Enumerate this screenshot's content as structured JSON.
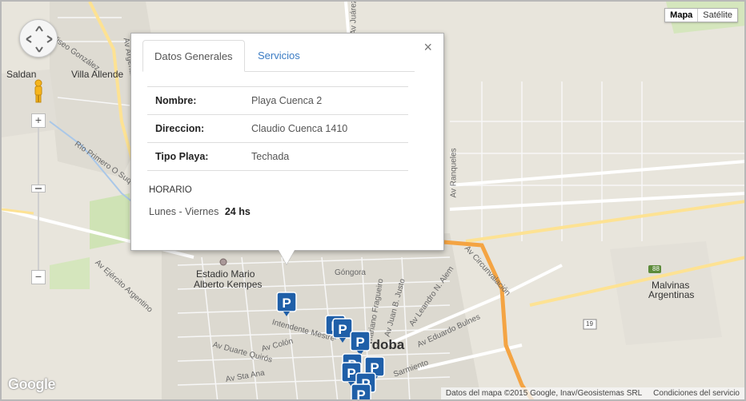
{
  "map_type": {
    "map": "Mapa",
    "satellite": "Satélite",
    "selected": "Mapa"
  },
  "controls": {
    "zoom_in": "+",
    "zoom_out": "−"
  },
  "labels": {
    "saldan": "Saldan",
    "villa_allende": "Villa Allende",
    "estadio_l1": "Estadio Mario",
    "estadio_l2": "Alberto Kempes",
    "malvinas_l1": "Malvinas",
    "malvinas_l2": "Argentinas",
    "cordoba": "rdoba",
    "cordoba_pre": "C",
    "av_circunvalacion": "Av Circunvalación",
    "av_ranqueles": "Av Ranqueles",
    "av_ejercito": "Av Ejército Argentino",
    "rio_primero": "Río Primero O Suquía",
    "eliseo_gonzalez": "Eliseo González",
    "av_argentina": "Av Argentina",
    "av_juarez": "Av Juárez",
    "gongora": "Góngora",
    "av_leandro_alem": "Av Leandro N. Alem",
    "av_eduardo_bulnes": "Av Eduardo Bulnes",
    "av_juan_justo": "Av Juan B. Justo",
    "mariano_fragueiro": "Mariano Fragueiro",
    "intendente_mestre": "Intendente Mestre",
    "av_duarte_quiros": "Av Duarte Quirós",
    "av_colon": "Av Colón",
    "av_sta_ana": "Av Sta Ana",
    "sarmiento": "Sarmiento",
    "juarez_celman": "Juárez Celman",
    "route_88": "88",
    "route_19": "19"
  },
  "google_logo": "Google",
  "attribution": {
    "data": "Datos del mapa ©2015 Google, Inav/Geosistemas SRL",
    "terms": "Condiciones del servicio"
  },
  "info_window": {
    "tabs": [
      "Datos Generales",
      "Servicios"
    ],
    "active_tab": "Datos Generales",
    "close": "×",
    "rows": [
      {
        "key": "Nombre:",
        "value": "Playa Cuenca 2"
      },
      {
        "key": "Direccion:",
        "value": "Claudio Cuenca 1410"
      },
      {
        "key": "Tipo Playa:",
        "value": "Techada"
      }
    ],
    "horario_title": "HORARIO",
    "horario_days": "Lunes - Viernes",
    "horario_hours": "24 hs"
  },
  "colors": {
    "marker": "#1f5fa8",
    "circunvalacion": "#f4a443",
    "highway": "#fde293"
  },
  "icons": [
    "pan-control-icon",
    "pegman-icon",
    "parking-marker-icon",
    "close-icon"
  ]
}
